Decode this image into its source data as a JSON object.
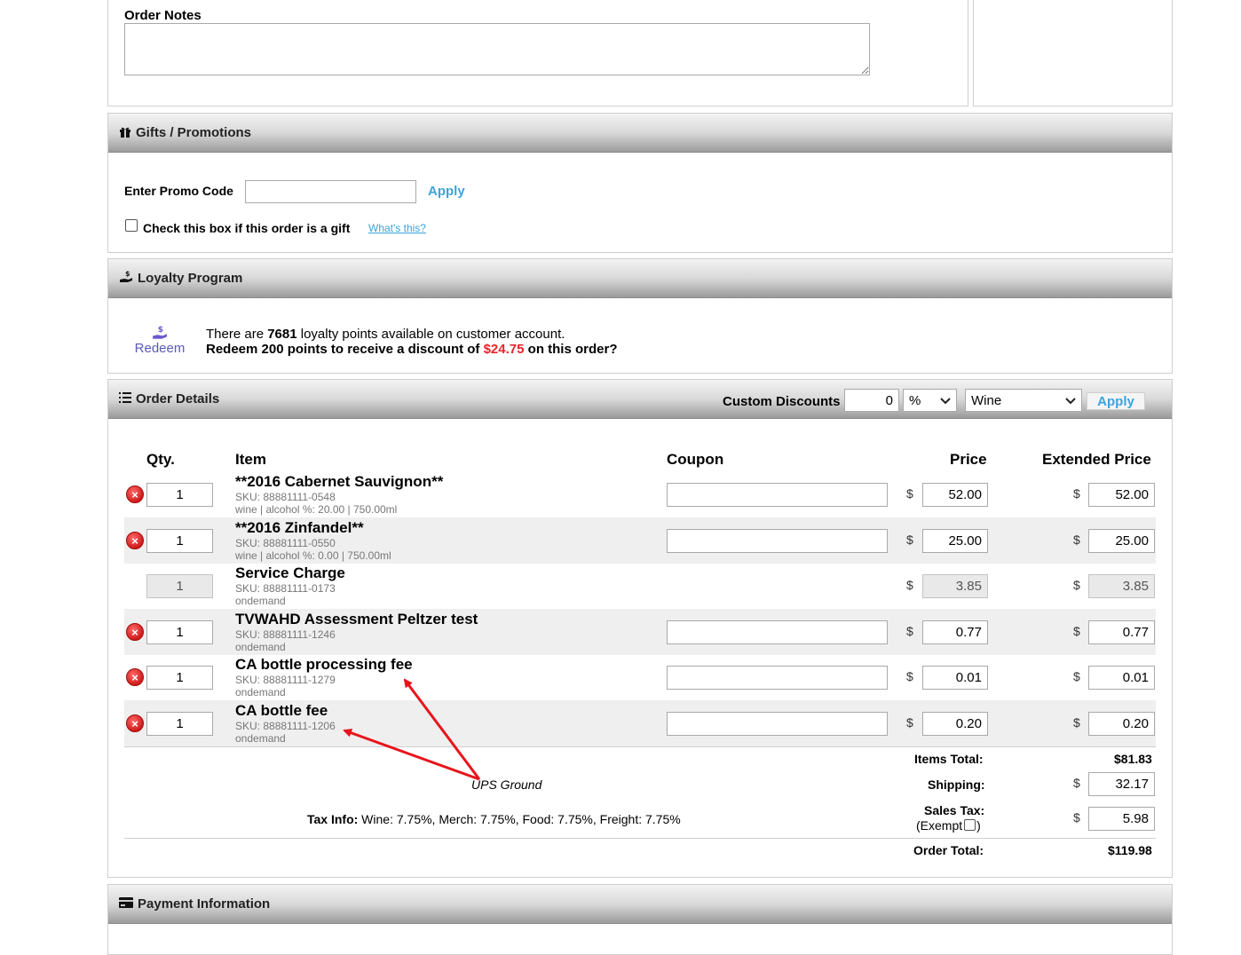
{
  "order_notes": {
    "label": "Order Notes",
    "value": ""
  },
  "gifts": {
    "title": "Gifts / Promotions",
    "promo_label": "Enter Promo Code",
    "promo_value": "",
    "apply_label": "Apply",
    "gift_label": "Check this box if this order is a gift",
    "whats_this": "What's this?"
  },
  "loyalty": {
    "title": "Loyalty Program",
    "redeem_label": "Redeem",
    "line1_pre": "There are ",
    "points": "7681",
    "line1_post": " loyalty points available on customer account.",
    "line2_pre": "Redeem 200 points to receive a discount of ",
    "discount": "$24.75",
    "line2_post": " on this order?"
  },
  "order_details": {
    "title": "Order Details",
    "custom_discounts_label": "Custom Discounts",
    "discount_value": "0",
    "discount_type": "%",
    "discount_category": "Wine",
    "apply_label": "Apply",
    "columns": {
      "qty": "Qty.",
      "item": "Item",
      "coupon": "Coupon",
      "price": "Price",
      "extended": "Extended Price"
    },
    "currency": "$",
    "items": [
      {
        "qty": "1",
        "name": "**2016 Cabernet Sauvignon**",
        "sku": "SKU: 88881111-0548",
        "meta": "wine | alcohol %: 20.00 | 750.00ml",
        "price": "52.00",
        "extended": "52.00"
      },
      {
        "qty": "1",
        "name": "**2016 Zinfandel**",
        "sku": "SKU: 88881111-0550",
        "meta": "wine | alcohol %: 0.00 | 750.00ml",
        "price": "25.00",
        "extended": "25.00"
      },
      {
        "qty": "1",
        "name": "Service Charge",
        "sku": "SKU: 88881111-0173",
        "meta": "ondemand",
        "price": "3.85",
        "extended": "3.85"
      },
      {
        "qty": "1",
        "name": "TVWAHD Assessment Peltzer test",
        "sku": "SKU: 88881111-1246",
        "meta": "ondemand",
        "price": "0.77",
        "extended": "0.77"
      },
      {
        "qty": "1",
        "name": "CA bottle processing fee",
        "sku": "SKU: 88881111-1279",
        "meta": "ondemand",
        "price": "0.01",
        "extended": "0.01"
      },
      {
        "qty": "1",
        "name": "CA bottle fee",
        "sku": "SKU: 88881111-1206",
        "meta": "ondemand",
        "price": "0.20",
        "extended": "0.20"
      }
    ],
    "totals": {
      "items_total_label": "Items Total:",
      "items_total": "$81.83",
      "shipping_label": "Shipping:",
      "shipping": "32.17",
      "shipping_method": "UPS Ground",
      "sales_tax_label": "Sales Tax:",
      "exempt_open": "(Exempt",
      "exempt_close": ")",
      "sales_tax": "5.98",
      "order_total_label": "Order Total:",
      "order_total": "$119.98"
    },
    "tax_info_label": "Tax Info:",
    "tax_info": " Wine: 7.75%, Merch: 7.75%, Food: 7.75%, Freight: 7.75%"
  },
  "payment": {
    "title": "Payment Information"
  }
}
